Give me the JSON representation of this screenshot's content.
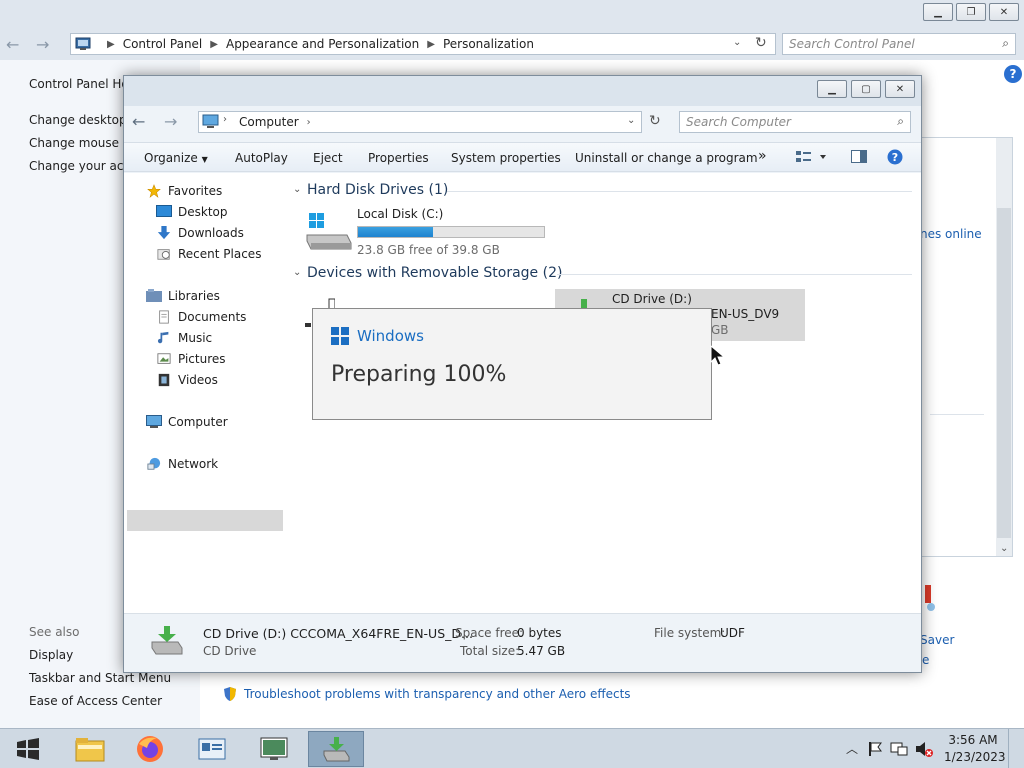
{
  "control_panel": {
    "address": {
      "root_icon": "control-panel-icon",
      "crumbs": [
        "Control Panel",
        "Appearance and Personalization",
        "Personalization"
      ]
    },
    "search_placeholder": "Search Control Panel",
    "left_links": [
      "Control Panel Hor",
      "Change desktop i",
      "Change mouse po",
      "Change your acco"
    ],
    "see_also_label": "See also",
    "see_also_links": [
      "Display",
      "Taskbar and Start Menu",
      "Ease of Access Center"
    ],
    "troubleshoot_link": "Troubleshoot problems with transparency and other Aero effects",
    "right_partial_link": "nes online",
    "screen_saver_partial": "Saver",
    "partial_e": "e"
  },
  "explorer": {
    "address": {
      "crumb": "Computer"
    },
    "search_placeholder": "Search Computer",
    "toolbar": {
      "organize": "Organize",
      "autoplay": "AutoPlay",
      "eject": "Eject",
      "properties": "Properties",
      "system_properties": "System properties",
      "uninstall": "Uninstall or change a program",
      "more": "»"
    },
    "nav": {
      "favorites": "Favorites",
      "desktop": "Desktop",
      "downloads": "Downloads",
      "recent_places": "Recent Places",
      "libraries": "Libraries",
      "documents": "Documents",
      "music": "Music",
      "pictures": "Pictures",
      "videos": "Videos",
      "computer": "Computer",
      "network": "Network"
    },
    "groups": {
      "hard_disk": "Hard Disk Drives (1)",
      "removable": "Devices with Removable Storage (2)"
    },
    "local_disk": {
      "name": "Local Disk (C:)",
      "free_text": "23.8 GB free of 39.8 GB",
      "used_fraction": 0.402
    },
    "cd_drive_tile": {
      "name": "CD Drive (D:)",
      "label_partial": "EN-US_DV9",
      "size_partial": "GB"
    },
    "details": {
      "title": "CD Drive (D:) CCCOMA_X64FRE_EN-US_D...",
      "type": "CD Drive",
      "space_free_label": "Space free:",
      "space_free_value": "0 bytes",
      "total_size_label": "Total size:",
      "total_size_value": "5.47 GB",
      "file_system_label": "File system:",
      "file_system_value": "UDF"
    }
  },
  "popup": {
    "brand": "Windows",
    "status": "Preparing 100%"
  },
  "taskbar": {
    "time": "3:56 AM",
    "date": "1/23/2023",
    "colors": {
      "accent": "#1e82cf"
    }
  }
}
